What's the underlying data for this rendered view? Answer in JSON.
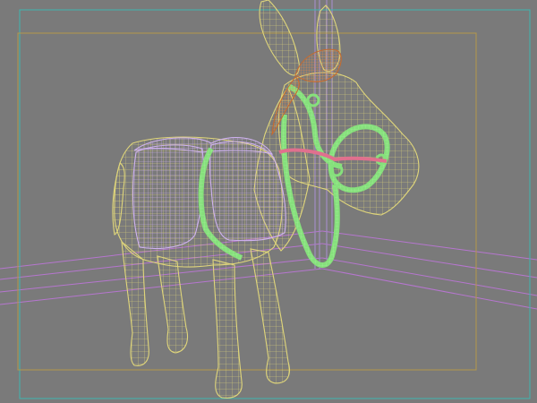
{
  "viewport": {
    "background": "#7a7a7a"
  },
  "colors": {
    "safe_frame": "#3fb6b0",
    "render_frame": "#b4984a",
    "floor_grid": "#b676cf",
    "post": "#9f8bbf",
    "body_wire": "#e0d67a",
    "saddle_wire": "#cfb2f0",
    "bridle_wire": "#86e07c",
    "browband": "#e0708e",
    "mane": "#c86a2c"
  },
  "objects": [
    "donkey-body",
    "saddle-blanket",
    "bridle",
    "mane",
    "floor-grid",
    "corner-post"
  ]
}
